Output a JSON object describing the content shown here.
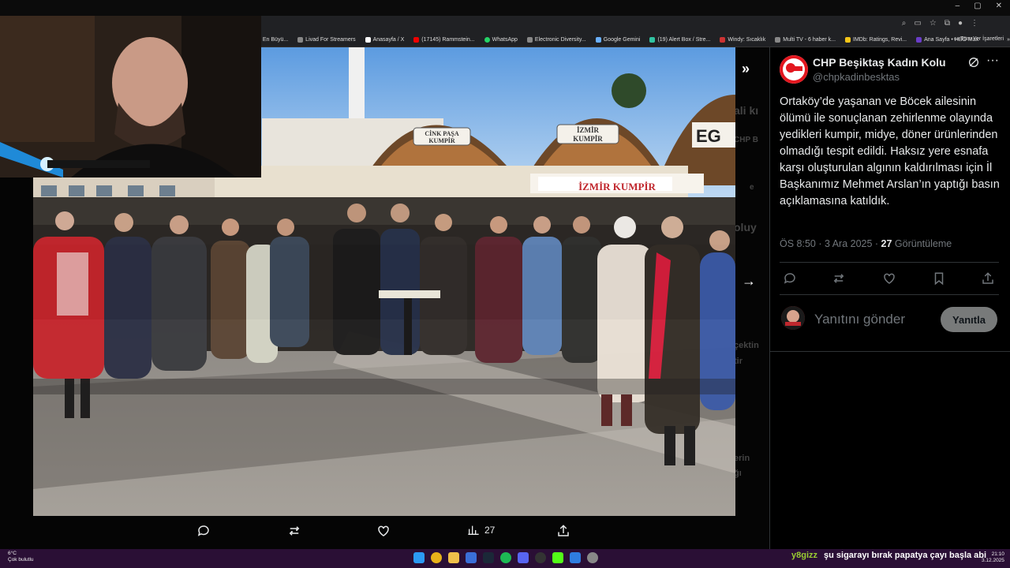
{
  "browser": {
    "window_controls": [
      "–",
      "▢",
      "✕"
    ],
    "bookmarks": [
      {
        "label": "Y'nin En Büyü...",
        "icon": "bookmark-icon"
      },
      {
        "label": "Livad For Streamers",
        "icon": "livad-icon"
      },
      {
        "label": "Anasayfa / X",
        "icon": "x-icon"
      },
      {
        "label": "(17145) Rammstein...",
        "icon": "youtube-icon"
      },
      {
        "label": "WhatsApp",
        "icon": "whatsapp-icon"
      },
      {
        "label": "Electronic Diversity...",
        "icon": "bookmark-icon"
      },
      {
        "label": "Google Gemini",
        "icon": "gemini-icon"
      },
      {
        "label": "(19) Alert Box / Stre...",
        "icon": "streamlabs-icon"
      },
      {
        "label": "Windy: Sıcaklık",
        "icon": "windy-icon"
      },
      {
        "label": "Multi TV - 6 haber k...",
        "icon": "tv-icon"
      },
      {
        "label": "IMDb: Ratings, Revi...",
        "icon": "imdb-icon"
      },
      {
        "label": "Ana Sayfa • HBO Max",
        "icon": "hbo-icon"
      }
    ],
    "more_bookmarks": "»",
    "all_bookmarks": "Tüm Yer İşaretleri"
  },
  "photo": {
    "signs": [
      "CİNK PAŞA\nKUMPİR",
      "İZMİR\nKUMPİR",
      "İZMİR KUMPİR",
      "EG"
    ]
  },
  "media_actions": {
    "views": "27"
  },
  "tweet": {
    "author": "CHP Beşiktaş Kadın Kolu",
    "handle": "@chpkadinbesktas",
    "text": "Ortaköy’de yaşanan ve Böcek ailesinin ölümü ile sonuçlanan zehirlenme olayında yedikleri kumpir, midye, döner ürünlerinden olmadığı tespit edildi. Haksız yere esnafa karşı oluşturulan algının kaldırılması için İl Başkanımız Mehmet Arslan’ın yaptığı basın açıklamasına katıldık.",
    "time": "ÖS 8:50 · 3 Ara 2025 · ",
    "view_count": "27",
    "view_label": " Görüntüleme",
    "reply_placeholder": "Yanıtını gönder",
    "reply_button": "Yanıtla"
  },
  "ghost_text": [
    "ali kı",
    "CHP B",
    "e",
    "oluy",
    "çektin",
    "tir",
    "erin",
    "ğı"
  ],
  "taskbar": {
    "weather_temp": "6°C",
    "weather_desc": "Çok bulutlu",
    "ticker_user": "y8gizz",
    "ticker_text": "şu sigarayı bırak papatya çayı başla abi",
    "time": "21:10",
    "date": "3.12.2025"
  },
  "colors": {
    "accent_red": "#e3171f",
    "reply_button_bg": "#787a7a",
    "taskbar_bg": "#2a0f35"
  }
}
